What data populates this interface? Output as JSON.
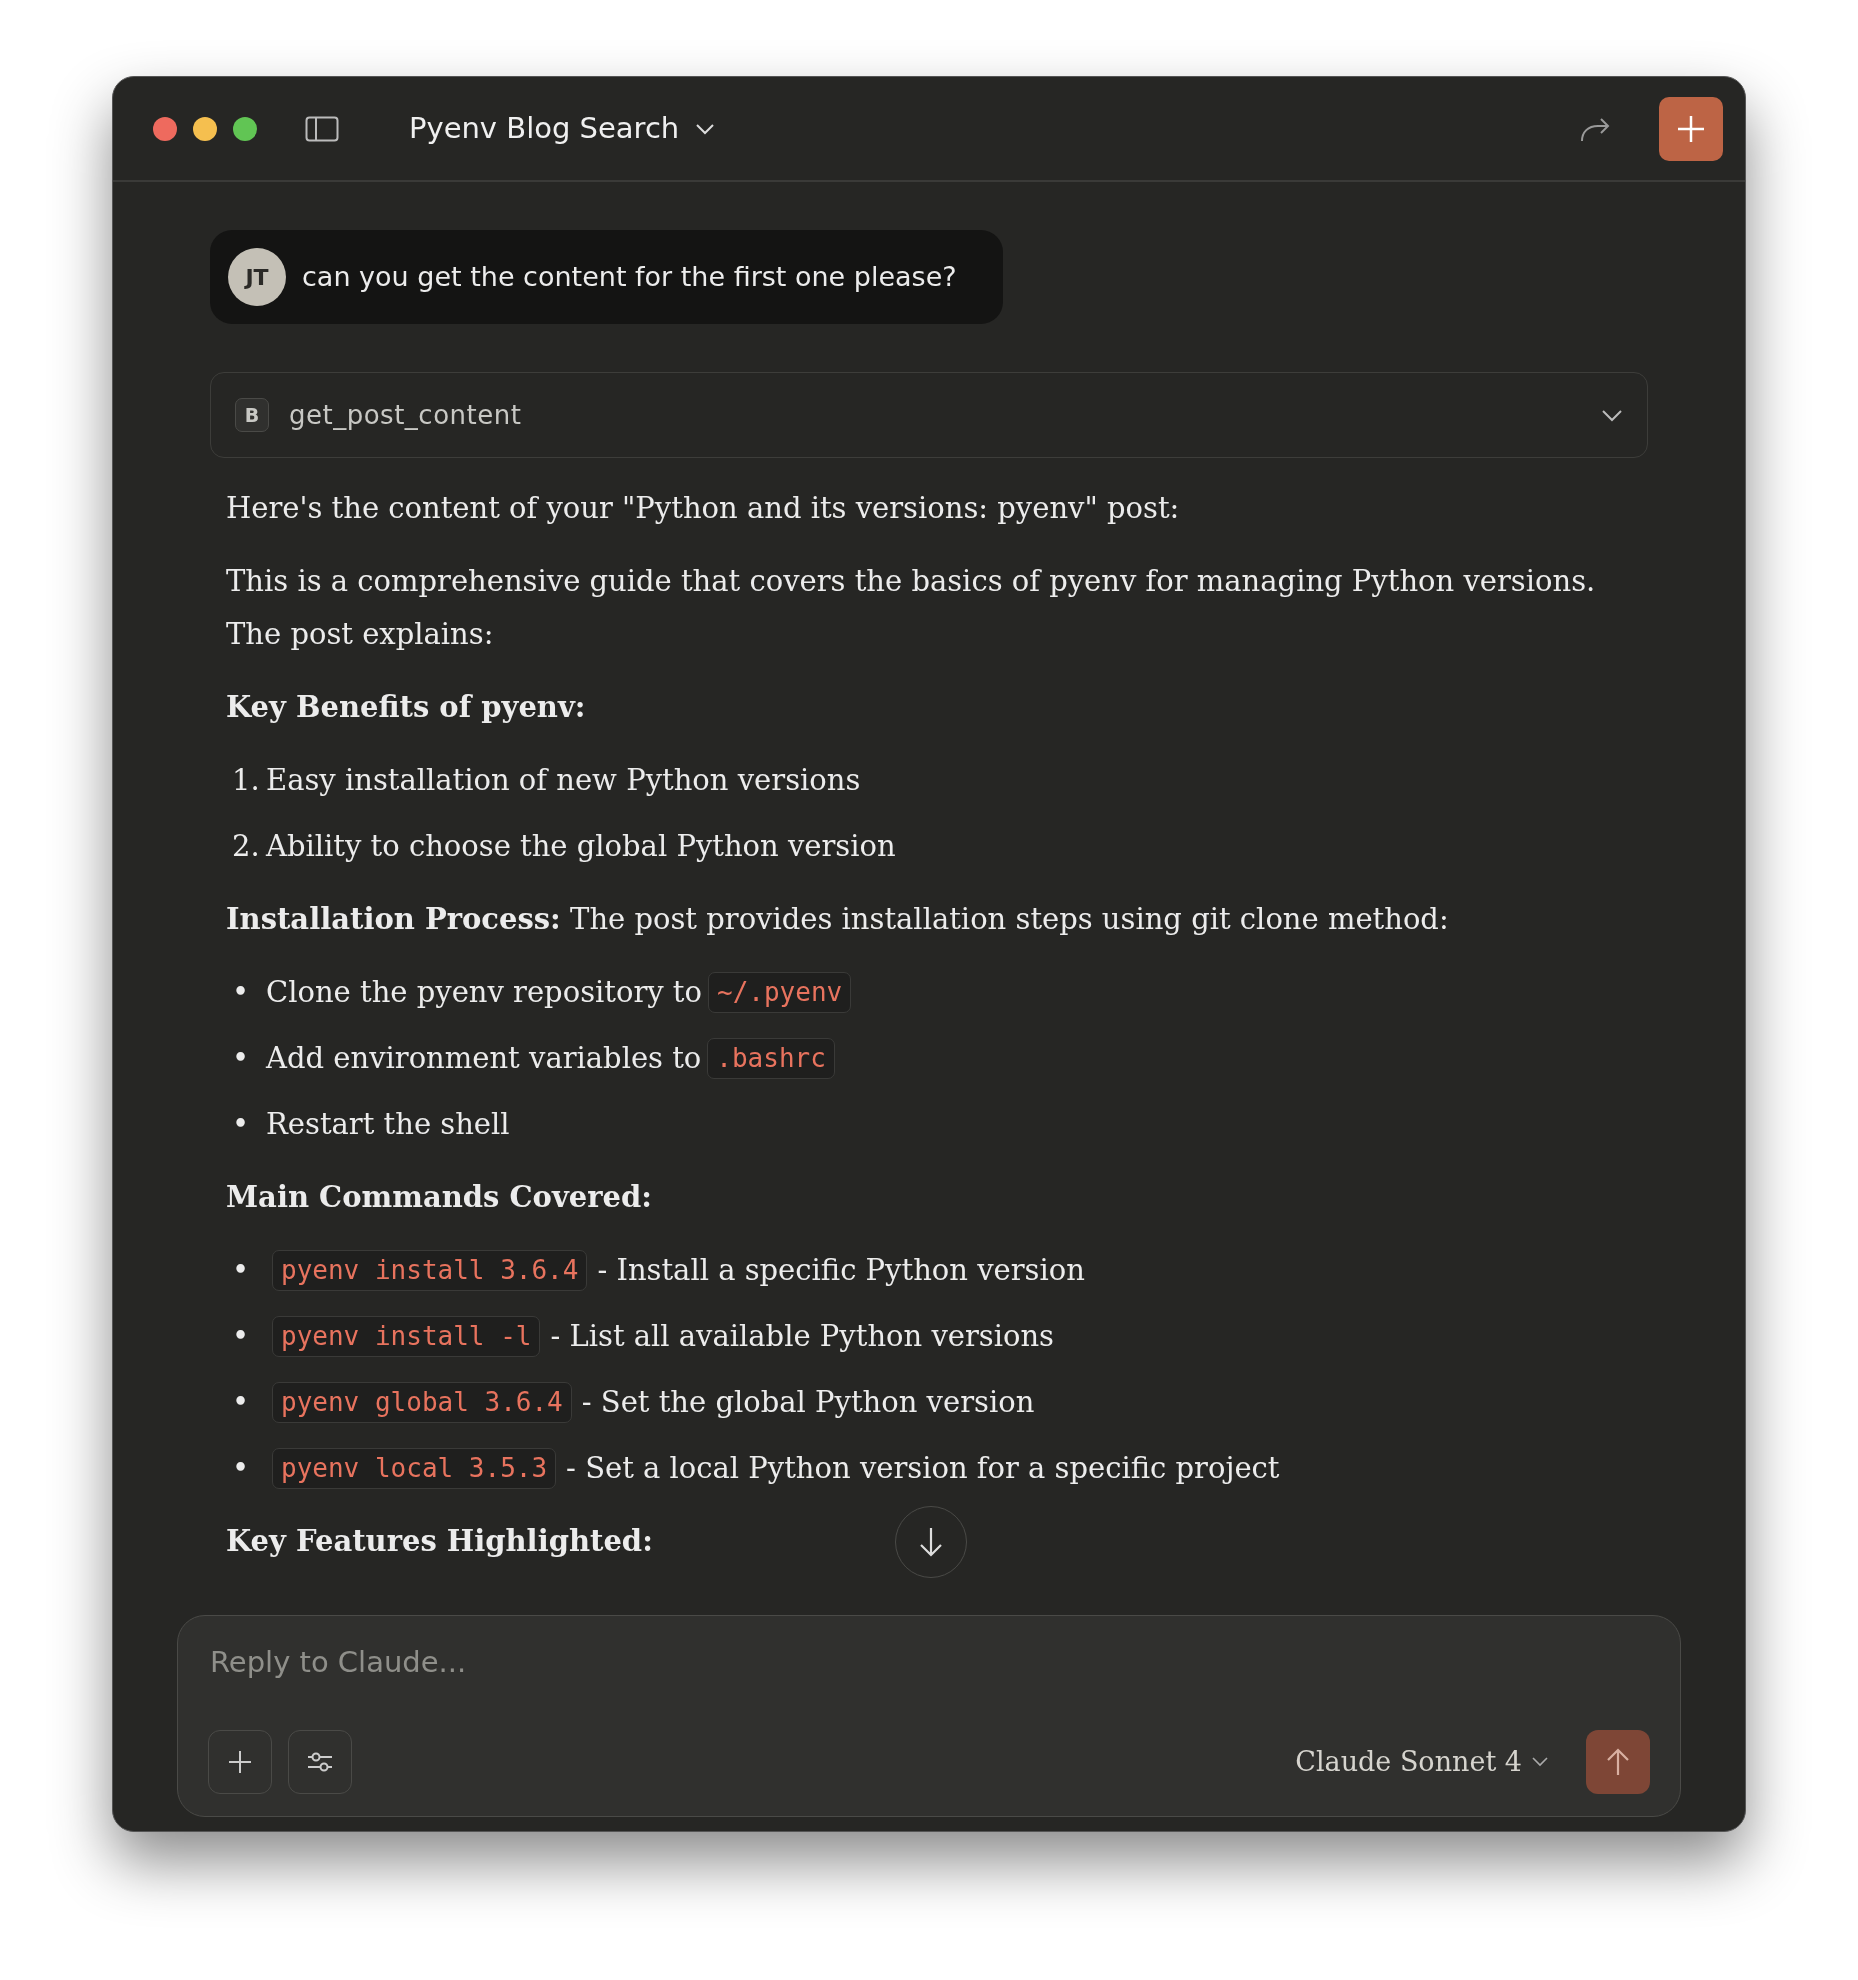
{
  "window": {
    "title": "Pyenv Blog Search"
  },
  "user_message": {
    "initials": "JT",
    "text": "can you get the content for the first one please?"
  },
  "tool_call": {
    "badge": "B",
    "name": "get_post_content",
    "expanded": false
  },
  "response": [
    {
      "kind": "paragraph",
      "text": "Here's the content of your \"Python and its versions: pyenv\" post:"
    },
    {
      "kind": "paragraph",
      "text": "This is a comprehensive guide that covers the basics of pyenv for managing Python versions. The post explains:"
    },
    {
      "kind": "heading",
      "text": "Key Benefits of pyenv:"
    },
    {
      "kind": "ordered_list",
      "items": [
        {
          "marker": "1.",
          "parts": [
            {
              "kind": "text",
              "text": "Easy installation of new Python versions"
            }
          ]
        },
        {
          "marker": "2.",
          "parts": [
            {
              "kind": "text",
              "text": "Ability to choose the global Python version"
            }
          ]
        }
      ]
    },
    {
      "kind": "paragraph",
      "text": "**Installation Process:** The post provides installation steps using git clone method:"
    },
    {
      "kind": "bullet_list",
      "items": [
        {
          "marker": "•",
          "parts": [
            {
              "kind": "text",
              "text": "Clone the pyenv repository to"
            },
            {
              "kind": "code",
              "text": "~/.pyenv"
            }
          ]
        },
        {
          "marker": "•",
          "parts": [
            {
              "kind": "text",
              "text": "Add environment variables to"
            },
            {
              "kind": "code",
              "text": ".bashrc"
            }
          ]
        },
        {
          "marker": "•",
          "parts": [
            {
              "kind": "text",
              "text": "Restart the shell"
            }
          ]
        }
      ]
    },
    {
      "kind": "heading",
      "text": "Main Commands Covered:"
    },
    {
      "kind": "bullet_list",
      "items": [
        {
          "marker": "•",
          "parts": [
            {
              "kind": "code",
              "text": "pyenv install 3.6.4"
            },
            {
              "kind": "text",
              "text": "- Install a specific Python version"
            }
          ]
        },
        {
          "marker": "•",
          "parts": [
            {
              "kind": "code",
              "text": "pyenv install -l"
            },
            {
              "kind": "text",
              "text": "- List all available Python versions"
            }
          ]
        },
        {
          "marker": "•",
          "parts": [
            {
              "kind": "code",
              "text": "pyenv global 3.6.4"
            },
            {
              "kind": "text",
              "text": "- Set the global Python version"
            }
          ]
        },
        {
          "marker": "•",
          "parts": [
            {
              "kind": "code",
              "text": "pyenv local 3.5.3"
            },
            {
              "kind": "text",
              "text": "- Set a local Python version for a specific project"
            }
          ]
        }
      ]
    },
    {
      "kind": "heading",
      "text": "Key Features Highlighted:"
    }
  ],
  "composer": {
    "placeholder": "Reply to Claude...",
    "model": "Claude Sonnet 4"
  }
}
